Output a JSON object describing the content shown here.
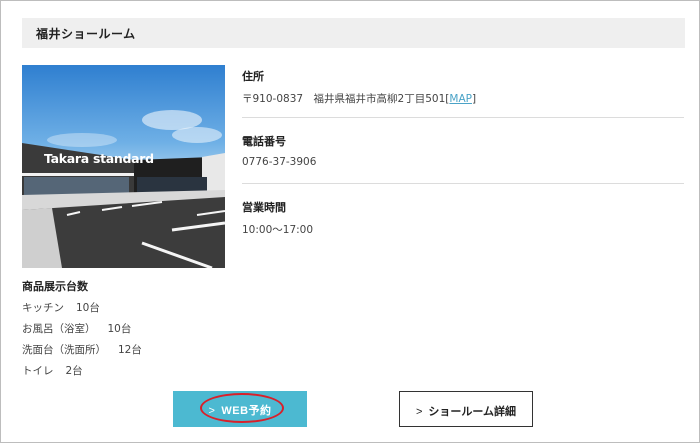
{
  "showroom": {
    "title": "福井ショールーム",
    "photo_sign": "Takara standard"
  },
  "info": {
    "address": {
      "label": "住所",
      "value": "〒910-0837　福井県福井市高柳2丁目501",
      "map_bracket_open": "[",
      "map_link": "MAP",
      "map_bracket_close": "]"
    },
    "phone": {
      "label": "電話番号",
      "value": "0776-37-3906"
    },
    "hours": {
      "label": "営業時間",
      "value": "10:00〜17:00"
    }
  },
  "display_counts": {
    "title": "商品展示台数",
    "items": [
      {
        "name": "キッチン",
        "count": "10台"
      },
      {
        "name": "お風呂（浴室）",
        "count": "10台"
      },
      {
        "name": "洗面台（洗面所）",
        "count": "12台"
      },
      {
        "name": "トイレ",
        "count": "2台"
      }
    ]
  },
  "buttons": {
    "chevron": ">",
    "web_reserve": "WEB予約",
    "showroom_detail": "ショールーム詳細"
  },
  "colors": {
    "header_bg": "#efefef",
    "web_button": "#4cb9d1",
    "highlight_oval": "#d9202a",
    "link": "#4aa3c7"
  }
}
